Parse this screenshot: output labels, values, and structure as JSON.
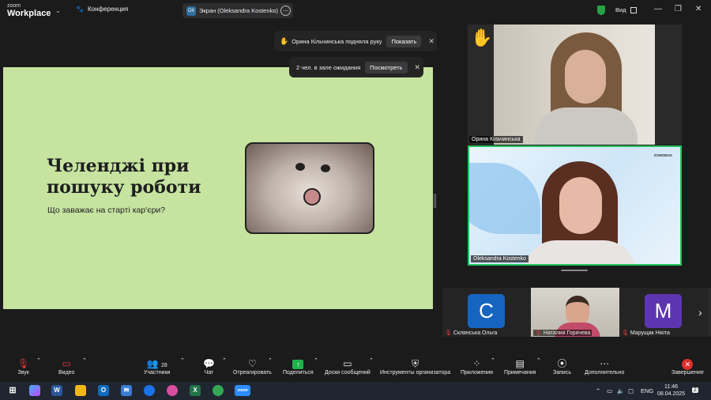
{
  "app": {
    "logo_small": "zoom",
    "logo_big": "Workplace",
    "meeting_label": "Конференция",
    "share_initials": "OK",
    "share_label": "Экран (Oleksandra Kostenko)",
    "view_label": "Вид"
  },
  "colors": {
    "slide_bg": "#c6e3a0",
    "share_green": "#22b14c",
    "end_red": "#e02d2d",
    "active_border": "#22c55e"
  },
  "slide": {
    "title_line1": "Челенджі при",
    "title_line2": "пошуку роботи",
    "subtitle": "Що заважає на старті кар'єри?"
  },
  "toasts": {
    "raise_hand_text": "Орина Кільчинська подняла руку",
    "raise_hand_button": "Показать",
    "waiting_text": "2 чел. в зале ожидания",
    "waiting_button": "Посмотреть",
    "close_glyph": "✕"
  },
  "tiles": {
    "speaker1_name": "Орина Кільчинська",
    "speaker2_name": "Oleksandra Kostenko",
    "brand": "ZOMOBOX"
  },
  "strip": [
    {
      "initial": "С",
      "name": "Склянська Ольга",
      "color": "#1565c0"
    },
    {
      "initial": "",
      "name": "Наталия Горячева",
      "color": ""
    },
    {
      "initial": "M",
      "name": "Марущак Нікіта",
      "color": "#5e35b1"
    }
  ],
  "toolbar": {
    "audio": "Звук",
    "video": "Видео",
    "participants": "Участники",
    "participants_count": "28",
    "chat": "Чат",
    "react": "Отреагировать",
    "share": "Поделиться",
    "whiteboards": "Доски сообщений",
    "host_tools": "Инструменты организатора",
    "apps": "Приложения",
    "notes": "Примечания",
    "record": "Запись",
    "more": "Дополнительно",
    "end": "Завершение"
  },
  "taskbar": {
    "lang": "ENG",
    "time": "11:46",
    "date": "08.04.2025",
    "notif_count": "2"
  }
}
